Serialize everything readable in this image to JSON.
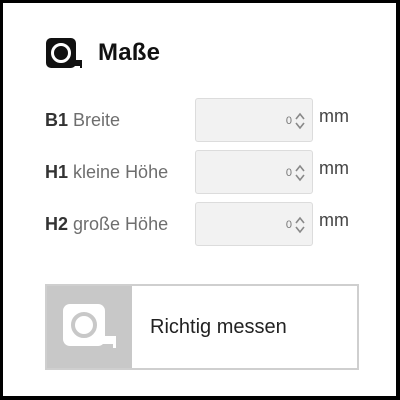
{
  "section": {
    "title": "Maße",
    "icon": "tape-measure-icon"
  },
  "fields": [
    {
      "code": "B1",
      "label": "Breite",
      "value": "0",
      "unit": "mm"
    },
    {
      "code": "H1",
      "label": "kleine Höhe",
      "value": "0",
      "unit": "mm"
    },
    {
      "code": "H2",
      "label": "große Höhe",
      "value": "0",
      "unit": "mm"
    }
  ],
  "measure_button": {
    "label": "Richtig messen",
    "icon": "tape-measure-icon"
  },
  "colors": {
    "icon_dark": "#111111",
    "icon_box": "#c8c8c8",
    "input_bg": "#f2f2f2",
    "label_text": "#6e6e6e"
  }
}
